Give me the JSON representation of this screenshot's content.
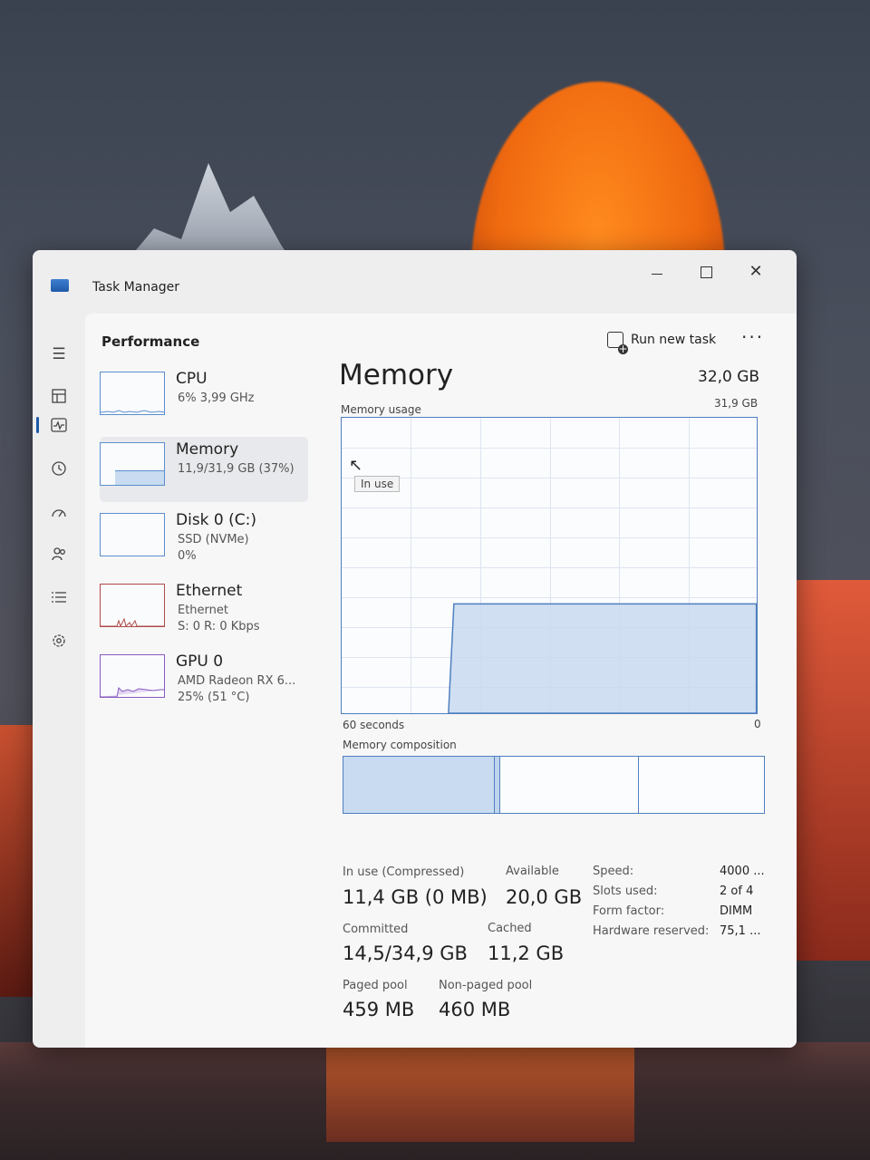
{
  "window": {
    "title": "Task Manager"
  },
  "header": {
    "page_title": "Performance",
    "run_task_label": "Run new task",
    "more_label": "···"
  },
  "nav": [
    {
      "icon": "hamburger-menu-icon"
    },
    {
      "icon": "processes-icon"
    },
    {
      "icon": "performance-icon"
    },
    {
      "icon": "app-history-icon"
    },
    {
      "icon": "startup-apps-icon"
    },
    {
      "icon": "users-icon"
    },
    {
      "icon": "details-icon"
    },
    {
      "icon": "services-icon"
    },
    {
      "icon": "settings-icon"
    }
  ],
  "sidebar": {
    "cpu": {
      "name": "CPU",
      "line1": "6% 3,99 GHz"
    },
    "memory": {
      "name": "Memory",
      "line1": "11,9/31,9 GB (37%)"
    },
    "disk": {
      "name": "Disk 0 (C:)",
      "line1": "SSD (NVMe)",
      "line2": "0%"
    },
    "ethernet": {
      "name": "Ethernet",
      "line1": "Ethernet",
      "line2": "S: 0 R: 0 Kbps"
    },
    "gpu": {
      "name": "GPU 0",
      "line1": "AMD Radeon RX 6...",
      "line2": "25% (51 °C)"
    }
  },
  "memory": {
    "title": "Memory",
    "total": "32,0 GB",
    "usage_label": "Memory usage",
    "usage_max": "31,9 GB",
    "in_use_tooltip": "In use",
    "axis_left": "60 seconds",
    "axis_right": "0",
    "composition_label": "Memory composition",
    "usage_fraction": 0.37,
    "composition": {
      "in_use_fraction": 0.36,
      "standby_fraction": 0.33
    }
  },
  "stats": {
    "in_use_label": "In use (Compressed)",
    "in_use_value": "11,4 GB (0 MB)",
    "available_label": "Available",
    "available_value": "20,0 GB",
    "committed_label": "Committed",
    "committed_value": "14,5/34,9 GB",
    "cached_label": "Cached",
    "cached_value": "11,2 GB",
    "paged_label": "Paged pool",
    "paged_value": "459 MB",
    "nonpaged_label": "Non-paged pool",
    "nonpaged_value": "460 MB"
  },
  "specs": [
    {
      "key": "Speed:",
      "value": "4000 ..."
    },
    {
      "key": "Slots used:",
      "value": "2 of 4"
    },
    {
      "key": "Form factor:",
      "value": "DIMM"
    },
    {
      "key": "Hardware reserved:",
      "value": "75,1 ..."
    }
  ]
}
